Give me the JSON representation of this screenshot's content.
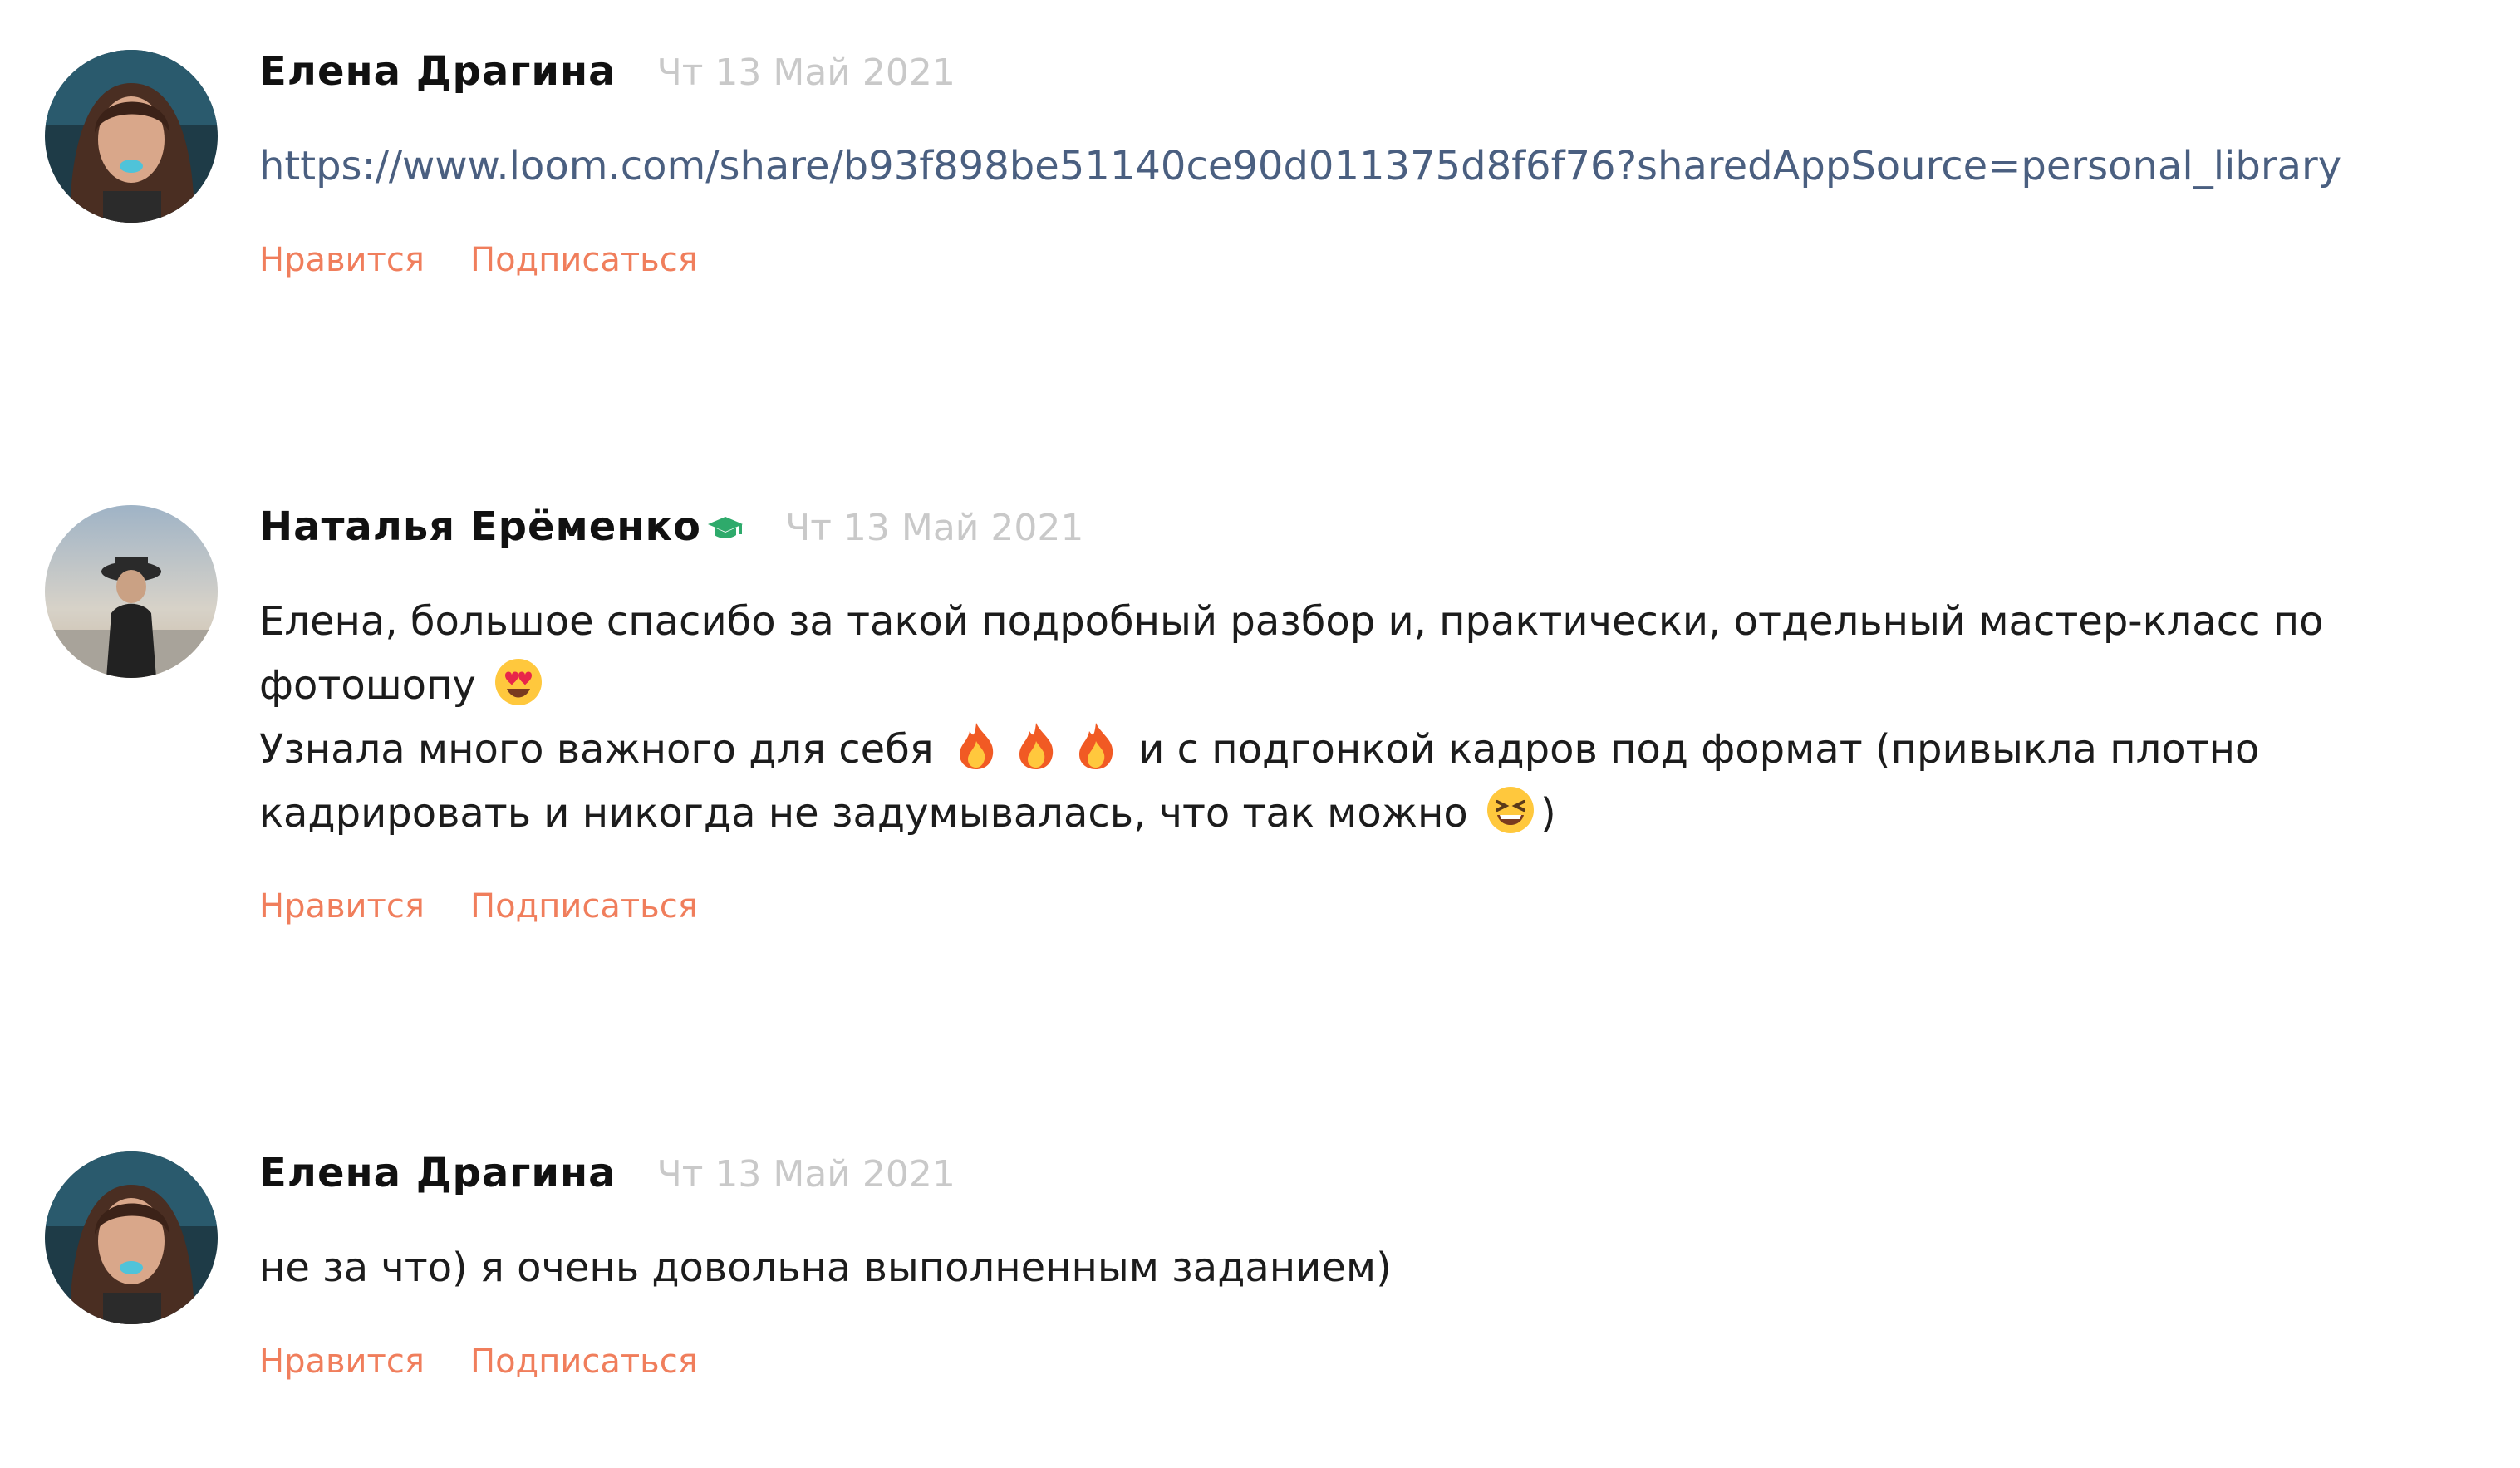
{
  "comments": [
    {
      "author": "Елена Драгина",
      "date": "Чт 13 Май 2021",
      "link": "https://www.loom.com/share/b93f898be51140ce90d011375d8f6f76?sharedAppSource=personal_library",
      "actions": {
        "like": "Нравится",
        "subscribe": "Подписаться"
      }
    },
    {
      "author": "Наталья Ерёменко",
      "author_badge_icon": "graduation-cap-icon",
      "date": "Чт 13 Май 2021",
      "text": {
        "line1": "Елена, большое спасибо за такой подробный разбор и, практически, отдельный мастер-класс по",
        "line2": "фотошопу",
        "line3_a": "Узнала много важного для себя",
        "line3_b": "и с подгонкой кадров под формат (привыкла плотно",
        "line4_a": "кадрировать и никогда не задумывалась, что так можно",
        "line4_b": ")"
      },
      "emoji": {
        "heart_eyes": "heart-eyes-emoji",
        "fire": "fire-emoji",
        "laughing": "laughing-emoji"
      },
      "actions": {
        "like": "Нравится",
        "subscribe": "Подписаться"
      }
    },
    {
      "author": "Елена Драгина",
      "date": "Чт 13 Май 2021",
      "text": "не за что) я очень довольна выполненным заданием)",
      "actions": {
        "like": "Нравится",
        "subscribe": "Подписаться"
      }
    }
  ],
  "colors": {
    "author": "#111111",
    "date": "#c9c9c9",
    "link": "#4a5f80",
    "action": "#f07e5c",
    "badge": "#2eaa6b"
  }
}
